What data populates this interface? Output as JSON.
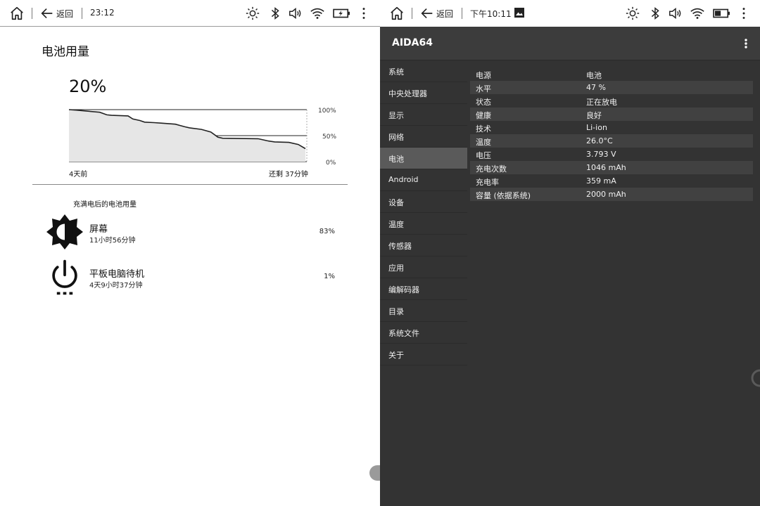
{
  "left_status": {
    "back_label": "返回",
    "time": "23:12",
    "icons": [
      "home-icon",
      "back-arrow-icon",
      "brightness-icon",
      "bluetooth-icon",
      "volume-icon",
      "wifi-icon",
      "battery-charging-icon",
      "more-vertical-icon"
    ]
  },
  "right_status": {
    "back_label": "返回",
    "time": "下午10:11",
    "icons": [
      "home-icon",
      "back-arrow-icon",
      "image-icon",
      "brightness-icon",
      "bluetooth-icon",
      "volume-icon",
      "wifi-icon",
      "battery-icon",
      "more-vertical-icon"
    ]
  },
  "battery_usage": {
    "title": "电池用量",
    "percent": "20%",
    "chart_data": {
      "type": "area",
      "x_start_label": "4天前",
      "x_end_label": "还剩 37分钟",
      "y_ticks": [
        "100%",
        "50%",
        "0%"
      ],
      "ylim": [
        0,
        100
      ],
      "grid": true,
      "x": [
        0,
        0.03,
        0.08,
        0.13,
        0.16,
        0.18,
        0.25,
        0.27,
        0.3,
        0.32,
        0.36,
        0.39,
        0.45,
        0.49,
        0.51,
        0.56,
        0.6,
        0.63,
        0.65,
        0.8,
        0.84,
        0.87,
        0.93,
        0.97,
        1.0
      ],
      "y": [
        100,
        99,
        97,
        95,
        90,
        89,
        88,
        82,
        79,
        76,
        75,
        74,
        72,
        67,
        65,
        62,
        57,
        47,
        45,
        44,
        40,
        38,
        37,
        33,
        25
      ]
    },
    "section_title": "充满电后的电池用量",
    "items": [
      {
        "icon": "screen-brightness-icon",
        "name": "屏幕",
        "duration": "11小时56分钟",
        "percent": "83%"
      },
      {
        "icon": "power-standby-icon",
        "name": "平板电脑待机",
        "duration": "4天9小时37分钟",
        "percent": "1%"
      }
    ]
  },
  "aida": {
    "app_title": "AIDA64",
    "nav": [
      {
        "label": "系统",
        "active": false
      },
      {
        "label": "中央处理器",
        "active": false
      },
      {
        "label": "显示",
        "active": false
      },
      {
        "label": "网络",
        "active": false
      },
      {
        "label": "电池",
        "active": true
      },
      {
        "label": "Android",
        "active": false
      },
      {
        "label": "设备",
        "active": false
      },
      {
        "label": "温度",
        "active": false
      },
      {
        "label": "传感器",
        "active": false
      },
      {
        "label": "应用",
        "active": false
      },
      {
        "label": "编解码器",
        "active": false
      },
      {
        "label": "目录",
        "active": false
      },
      {
        "label": "系统文件",
        "active": false
      },
      {
        "label": "关于",
        "active": false
      }
    ],
    "details": [
      {
        "key": "电源",
        "value": "电池"
      },
      {
        "key": "水平",
        "value": "47 %"
      },
      {
        "key": "状态",
        "value": "正在放电"
      },
      {
        "key": "健康",
        "value": "良好"
      },
      {
        "key": "技术",
        "value": "Li-ion"
      },
      {
        "key": "温度",
        "value": "26.0°C"
      },
      {
        "key": "电压",
        "value": "3.793 V"
      },
      {
        "key": "充电次数",
        "value": "1046 mAh"
      },
      {
        "key": "充电率",
        "value": "359 mA"
      },
      {
        "key": "容量 (依据系统)",
        "value": "2000 mAh"
      }
    ]
  }
}
